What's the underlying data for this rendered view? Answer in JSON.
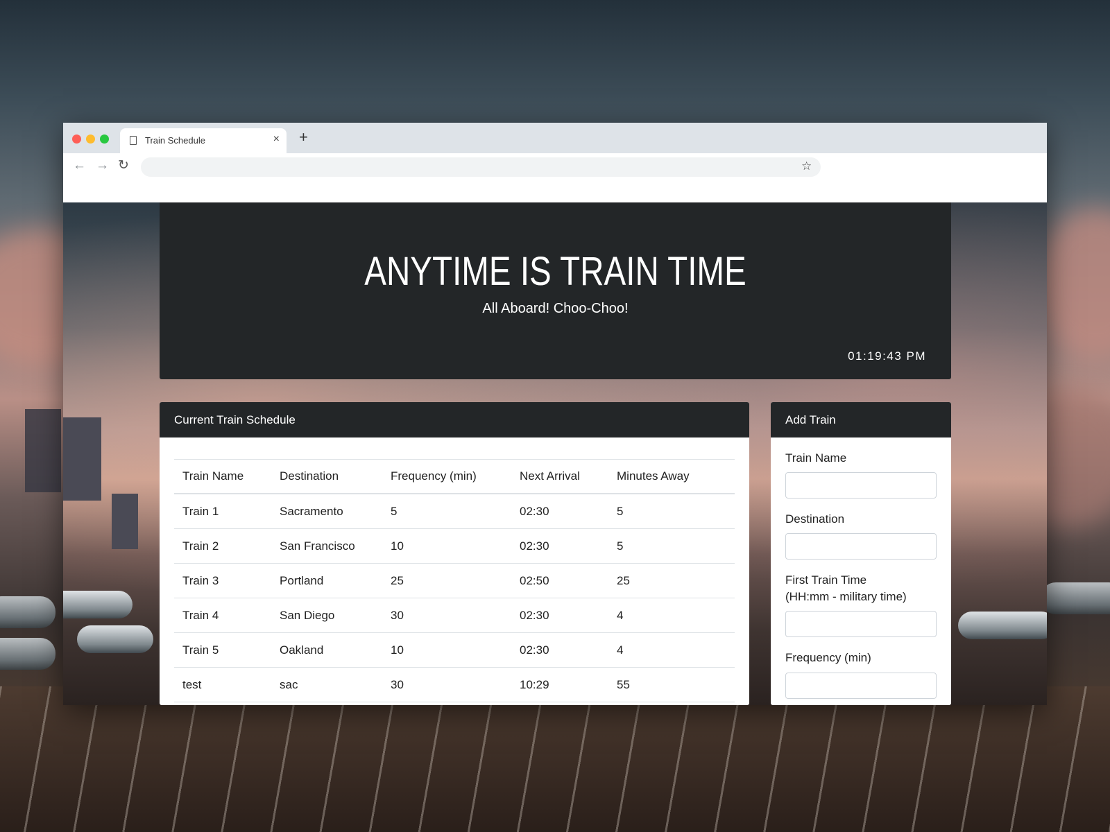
{
  "browser": {
    "tab_title": "Train Schedule",
    "tab_close": "×",
    "new_tab": "+",
    "back": "←",
    "forward": "→",
    "reload": "↻",
    "address": "",
    "star": "☆"
  },
  "hero": {
    "title": "ANYTIME IS TRAIN TIME",
    "subtitle": "All Aboard! Choo-Choo!",
    "clock": "01:19:43 PM"
  },
  "schedule": {
    "heading": "Current Train Schedule",
    "columns": [
      "Train Name",
      "Destination",
      "Frequency (min)",
      "Next Arrival",
      "Minutes Away"
    ],
    "rows": [
      [
        "Train 1",
        "Sacramento",
        "5",
        "02:30",
        "5"
      ],
      [
        "Train 2",
        "San Francisco",
        "10",
        "02:30",
        "5"
      ],
      [
        "Train 3",
        "Portland",
        "25",
        "02:50",
        "25"
      ],
      [
        "Train 4",
        "San Diego",
        "30",
        "02:30",
        "4"
      ],
      [
        "Train 5",
        "Oakland",
        "10",
        "02:30",
        "4"
      ],
      [
        "test",
        "sac",
        "30",
        "10:29",
        "55"
      ]
    ]
  },
  "add_train": {
    "heading": "Add Train",
    "train_name_label": "Train Name",
    "destination_label": "Destination",
    "first_time_label_1": "First Train Time",
    "first_time_label_2": "(HH:mm - military time)",
    "frequency_label": "Frequency (min)",
    "train_name_value": "",
    "destination_value": "",
    "first_time_value": "",
    "frequency_value": ""
  }
}
